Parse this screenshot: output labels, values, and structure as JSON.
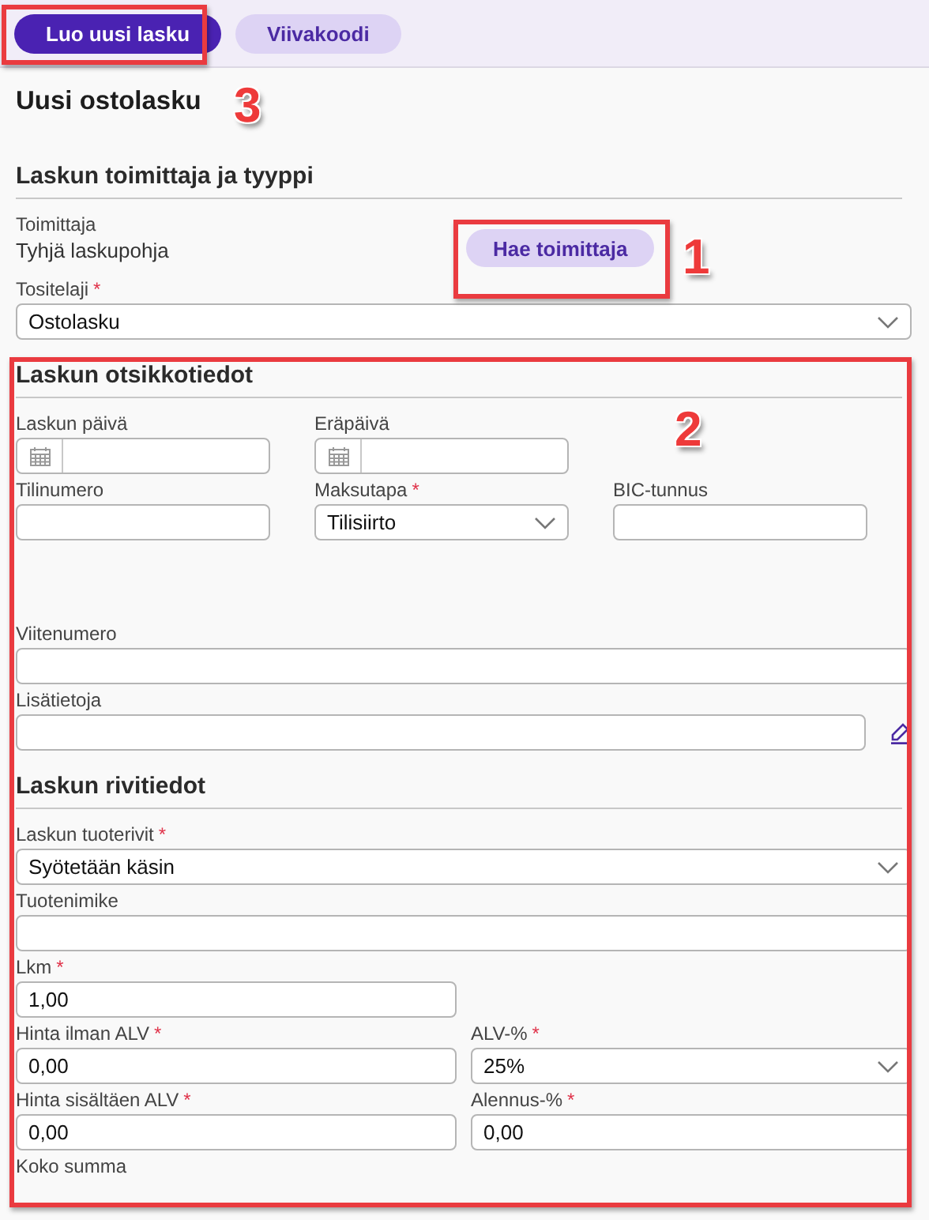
{
  "toolbar": {
    "buttons": [
      {
        "label": "Luo uusi lasku",
        "kind": "primary"
      },
      {
        "label": "Viivakoodi",
        "kind": "secondary"
      }
    ]
  },
  "title": "Uusi ostolasku",
  "sections": [
    {
      "heading": "Laskun toimittaja ja tyyppi",
      "rows": [
        [
          {
            "kind": "info",
            "label": "Toimittaja",
            "value": "Tyhjä laskupohja"
          },
          {
            "kind": "button",
            "label": "Hae toimittaja"
          }
        ],
        [
          {
            "kind": "select",
            "label": "Tositelaji",
            "required_mark": "*",
            "value": "Ostolasku"
          }
        ]
      ]
    },
    {
      "heading": "Laskun otsikkotiedot",
      "rows": [
        [
          {
            "kind": "date",
            "label": "Laskun päivä"
          },
          {
            "kind": "date",
            "label": "Eräpäivä"
          }
        ],
        [
          {
            "kind": "text",
            "label": "Tilinumero"
          },
          {
            "kind": "select",
            "label": "Maksutapa",
            "required_mark": "*",
            "value": "Tilisiirto"
          },
          {
            "kind": "text",
            "label": "BIC-tunnus"
          }
        ],
        [
          {
            "kind": "text",
            "label": "Viitenumero"
          }
        ],
        [
          {
            "kind": "note",
            "label": "Lisätietoja"
          }
        ]
      ]
    },
    {
      "heading": "Laskun rivitiedot",
      "rows": [
        [
          {
            "kind": "select",
            "label": "Laskun tuoterivit",
            "required_mark": "*",
            "value": "Syötetään käsin"
          }
        ],
        [
          {
            "kind": "text",
            "label": "Tuotenimike"
          }
        ],
        [
          {
            "kind": "text",
            "label": "Lkm",
            "required_mark": "*",
            "value": "1,00"
          }
        ],
        [
          {
            "kind": "text",
            "label": "Hinta ilman ALV",
            "required_mark": "*",
            "value": "0,00"
          },
          {
            "kind": "select",
            "label": "ALV-%",
            "required_mark": "*",
            "value": "25%"
          }
        ],
        [
          {
            "kind": "text",
            "label": "Hinta sisältäen ALV",
            "required_mark": "*",
            "value": "0,00"
          },
          {
            "kind": "text",
            "label": "Alennus-%",
            "required_mark": "*",
            "value": "0,00"
          }
        ],
        [
          {
            "kind": "label",
            "label": "Koko summa"
          }
        ]
      ]
    }
  ],
  "annotations": [
    {
      "kind": "box"
    },
    {
      "kind": "number",
      "text": "3"
    },
    {
      "kind": "box"
    },
    {
      "kind": "number",
      "text": "1"
    },
    {
      "kind": "box"
    },
    {
      "kind": "number",
      "text": "2"
    }
  ]
}
